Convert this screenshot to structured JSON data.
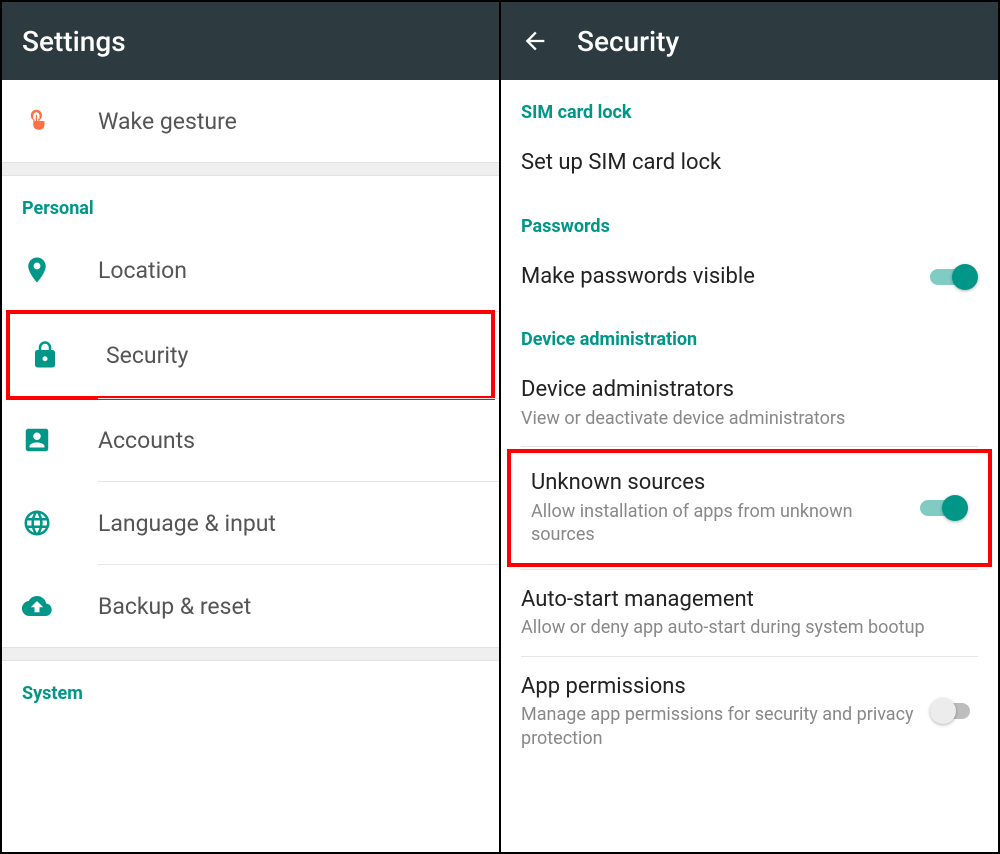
{
  "left": {
    "title": "Settings",
    "top_item": {
      "label": "Wake gesture"
    },
    "sections": [
      {
        "header": "Personal",
        "items": [
          {
            "key": "location",
            "label": "Location"
          },
          {
            "key": "security",
            "label": "Security",
            "highlighted": true
          },
          {
            "key": "accounts",
            "label": "Accounts"
          },
          {
            "key": "language",
            "label": "Language & input"
          },
          {
            "key": "backup",
            "label": "Backup & reset"
          }
        ]
      },
      {
        "header": "System",
        "items": []
      }
    ]
  },
  "right": {
    "title": "Security",
    "sections": [
      {
        "header": "SIM card lock",
        "items": [
          {
            "key": "sim_lock",
            "primary": "Set up SIM card lock"
          }
        ]
      },
      {
        "header": "Passwords",
        "items": [
          {
            "key": "pw_visible",
            "primary": "Make passwords visible",
            "toggle": "on"
          }
        ]
      },
      {
        "header": "Device administration",
        "items": [
          {
            "key": "dev_admin",
            "primary": "Device administrators",
            "secondary": "View or deactivate device administrators"
          },
          {
            "key": "unknown",
            "primary": "Unknown sources",
            "secondary": "Allow installation of apps from unknown sources",
            "toggle": "on",
            "highlighted": true
          },
          {
            "key": "autostart",
            "primary": "Auto-start management",
            "secondary": "Allow or deny app auto-start during system bootup"
          },
          {
            "key": "appperm",
            "primary": "App permissions",
            "secondary": "Manage app permissions for security and privacy protection",
            "toggle": "off"
          }
        ]
      }
    ]
  }
}
